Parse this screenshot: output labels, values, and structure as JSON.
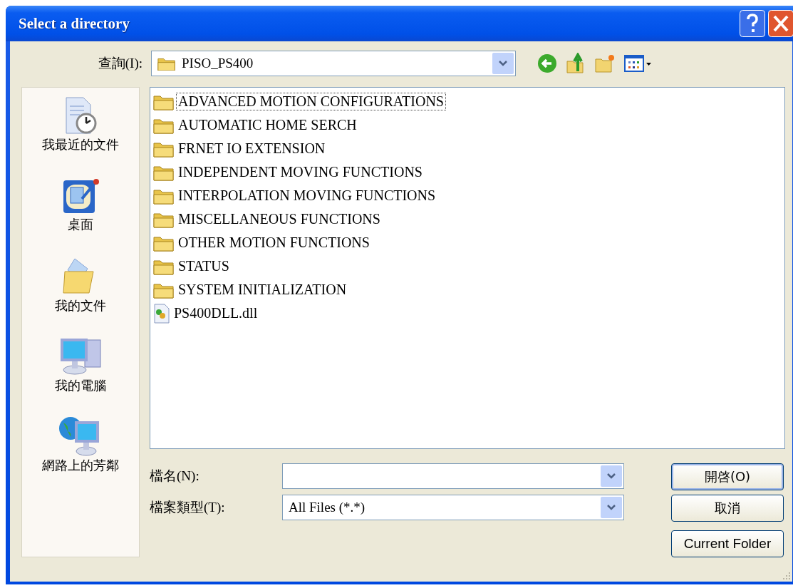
{
  "window": {
    "title": "Select a directory"
  },
  "look_in": {
    "label": "查詢(I):",
    "value": "PISO_PS400"
  },
  "places": [
    {
      "label": "我最近的文件",
      "kind": "recent"
    },
    {
      "label": "桌面",
      "kind": "desktop"
    },
    {
      "label": "我的文件",
      "kind": "documents"
    },
    {
      "label": "我的電腦",
      "kind": "computer"
    },
    {
      "label": "網路上的芳鄰",
      "kind": "network"
    }
  ],
  "files": [
    {
      "name": "ADVANCED MOTION CONFIGURATIONS",
      "kind": "folder",
      "focused": true
    },
    {
      "name": "AUTOMATIC HOME SERCH",
      "kind": "folder",
      "focused": false
    },
    {
      "name": "FRNET IO EXTENSION",
      "kind": "folder",
      "focused": false
    },
    {
      "name": "INDEPENDENT MOVING FUNCTIONS",
      "kind": "folder",
      "focused": false
    },
    {
      "name": "INTERPOLATION MOVING FUNCTIONS",
      "kind": "folder",
      "focused": false
    },
    {
      "name": "MISCELLANEOUS FUNCTIONS",
      "kind": "folder",
      "focused": false
    },
    {
      "name": "OTHER MOTION FUNCTIONS",
      "kind": "folder",
      "focused": false
    },
    {
      "name": "STATUS",
      "kind": "folder",
      "focused": false
    },
    {
      "name": "SYSTEM INITIALIZATION",
      "kind": "folder",
      "focused": false
    },
    {
      "name": "PS400DLL.dll",
      "kind": "dll",
      "focused": false
    }
  ],
  "file_name": {
    "label": "檔名(N):"
  },
  "file_type": {
    "label": "檔案類型(T):",
    "value": "All Files (*.*)"
  },
  "buttons": [
    "開啓(O)",
    "取消",
    "Current Folder"
  ]
}
